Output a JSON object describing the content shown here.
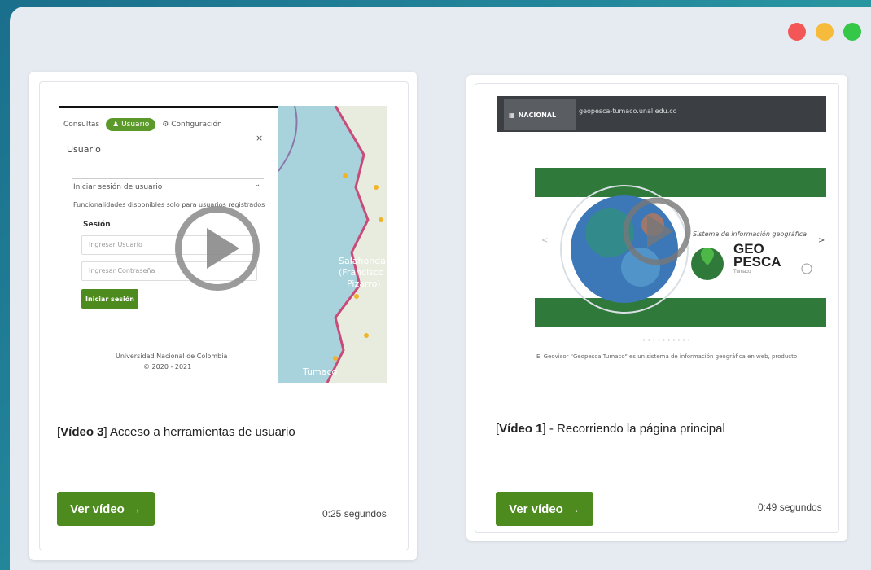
{
  "window": {
    "dot_colors": [
      "#f25656",
      "#f6bb3b",
      "#34c748"
    ]
  },
  "cards": [
    {
      "title_bold": "Vídeo 3",
      "title_rest": " Acceso a herramientas de usuario",
      "button_label": "Ver vídeo",
      "button_arrow": "→",
      "duration": "0:25 segundos",
      "thumb": {
        "tabs": [
          "Consultas",
          "Usuario",
          "Configuración"
        ],
        "panel_title": "Usuario",
        "close_glyph": "×",
        "section_label": "Iniciar sesión de usuario",
        "notice": "Funcionalidades disponibles solo para usuarios registrados",
        "session_label": "Sesión",
        "user_placeholder": "Ingresar Usuario",
        "password_placeholder": "Ingresar Contraseña",
        "login_button": "Iniciar sesión",
        "footer_line1": "Universidad Nacional de Colombia",
        "footer_line2": "© 2020 - 2021",
        "map_labels": [
          "Salahonda",
          "(Francisco",
          "Pizarro)",
          "Tumaco"
        ]
      }
    },
    {
      "title_bold": "Vídeo 1",
      "title_rest": " - Recorriendo la página principal",
      "button_label": "Ver vídeo",
      "button_arrow": "→",
      "duration": "0:49 segundos",
      "thumb": {
        "logo_text": "NACIONAL",
        "url": "geopesca-tumaco.unal.edu.co",
        "caption": "Sistema de información geográfica",
        "geo_line1": "GEO",
        "geo_line2": "PESCA",
        "geo_sub": "Tumaco",
        "body_text": "El Geovisor \"Geopesca Tumaco\" es un sistema de información geográfica en web, producto"
      }
    }
  ],
  "colors": {
    "accent_green": "#4d8b1f",
    "map_water": "#a8d3dc",
    "map_land": "#e8ecde",
    "banner_green": "#2f7a3a"
  }
}
